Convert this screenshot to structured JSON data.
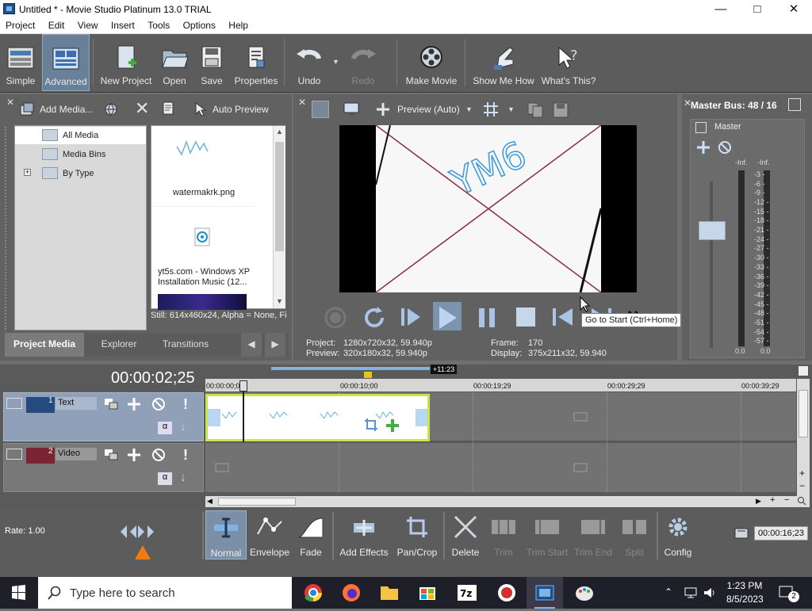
{
  "window": {
    "title": "Untitled * - Movie Studio Platinum 13.0 TRIAL",
    "minimize_icon": "minimize-icon",
    "maximize_icon": "maximize-icon",
    "close_icon": "close-icon"
  },
  "menu": [
    "Project",
    "Edit",
    "View",
    "Insert",
    "Tools",
    "Options",
    "Help"
  ],
  "toolbar": {
    "simple": "Simple",
    "advanced": "Advanced",
    "new_project": "New Project",
    "open": "Open",
    "save": "Save",
    "properties": "Properties",
    "undo": "Undo",
    "redo": "Redo",
    "make_movie": "Make Movie",
    "show_me_how": "Show Me How",
    "whats_this": "What's This?"
  },
  "media_panel": {
    "add_media": "Add Media...",
    "auto_preview": "Auto Preview",
    "tree": [
      "All Media",
      "Media Bins",
      "By Type"
    ],
    "items": [
      {
        "name": "watermakrk.png"
      },
      {
        "name": "yt5s.com - Windows XP Installation Music (12..."
      }
    ],
    "info": "Still: 614x460x24, Alpha = None, Fi",
    "tabs": [
      "Project Media",
      "Explorer",
      "Transitions"
    ]
  },
  "preview": {
    "mode": "Preview (Auto)",
    "watermark_text": "YM6",
    "tooltip": "Go to Start (Ctrl+Home)",
    "project_label": "Project:",
    "project_value": "1280x720x32, 59.940p",
    "preview_label": "Preview:",
    "preview_value": "320x180x32, 59.940p",
    "frame_label": "Frame:",
    "frame_value": "170",
    "display_label": "Display:",
    "display_value": "375x211x32, 59.940"
  },
  "master_bus": {
    "title": "Master Bus: 48 / 16",
    "label": "Master",
    "left_top": "-Inf.",
    "right_top": "-Inf.",
    "left_bottom": "0.0",
    "right_bottom": "0.0",
    "ticks": [
      "3",
      "6",
      "9",
      "12",
      "15",
      "18",
      "21",
      "24",
      "27",
      "30",
      "33",
      "36",
      "39",
      "42",
      "45",
      "48",
      "51",
      "54",
      "57"
    ]
  },
  "timeline": {
    "timecode": "00:00:02;25",
    "marker": "+11:23",
    "ruler": [
      "00:00:00;00",
      "00:00:10;00",
      "00:00:19;29",
      "00:00:29;29",
      "00:00:39;29"
    ],
    "tracks": [
      {
        "num": "1",
        "name": "Text"
      },
      {
        "num": "2",
        "name": "Video"
      }
    ],
    "end_timecode": "00:00:16;23"
  },
  "bottom": {
    "rate": "Rate: 1.00",
    "normal": "Normal",
    "envelope": "Envelope",
    "fade": "Fade",
    "add_effects": "Add Effects",
    "pan_crop": "Pan/Crop",
    "delete": "Delete",
    "trim": "Trim",
    "trim_start": "Trim Start",
    "trim_end": "Trim End",
    "split": "Split",
    "config": "Config"
  },
  "taskbar": {
    "search_placeholder": "Type here to search",
    "time": "1:23 PM",
    "date": "8/5/2023",
    "notification_count": "2"
  },
  "colors": {
    "accent": "#5b9bd5",
    "clip_border": "#c8e64a",
    "toolbar": "#5c5c5c"
  }
}
